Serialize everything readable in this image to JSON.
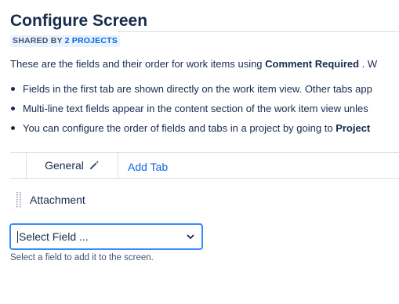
{
  "page": {
    "title": "Configure Screen",
    "shared": {
      "prefix": "SHARED BY",
      "link": "2 PROJECTS"
    },
    "intro": {
      "before": "These are the fields and their order for work items using ",
      "bold": "Comment Required",
      "after": " . W"
    },
    "notes": [
      {
        "text": "Fields in the first tab are shown directly on the work item view. Other tabs app"
      },
      {
        "text": "Multi-line text fields appear in the content section of the work item view unles"
      },
      {
        "text_before": "You can configure the order of fields and tabs in a project by going to ",
        "bold": "Project"
      }
    ]
  },
  "tabs": {
    "items": [
      {
        "label": "General",
        "icon": "pencil-icon"
      }
    ],
    "add_label": "Add Tab"
  },
  "fields": [
    {
      "label": "Attachment",
      "icon": "drag-handle-icon"
    }
  ],
  "select": {
    "value": "Select Field ...",
    "icon": "chevron-down-icon",
    "helper": "Select a field to add it to the screen."
  },
  "colors": {
    "link": "#0c66e4",
    "focus_border": "#388bff",
    "lozenge_bg": "#e9f2ff",
    "divider": "#dcdfe4",
    "text": "#172b4d"
  }
}
